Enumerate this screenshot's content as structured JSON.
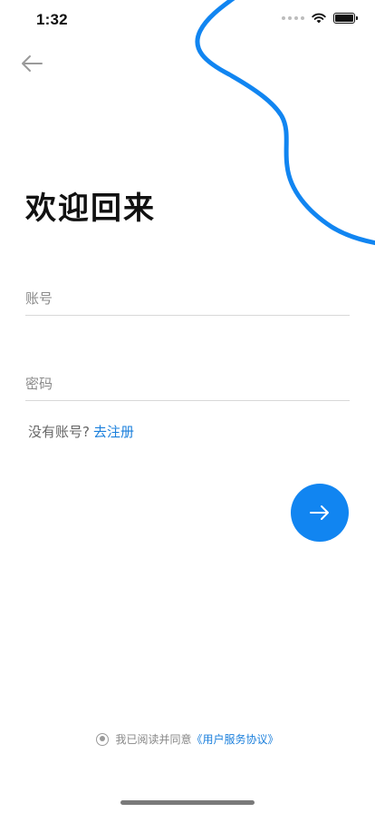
{
  "status_bar": {
    "time": "1:32"
  },
  "colors": {
    "accent": "#1185f1",
    "link": "#1a7fdc"
  },
  "header": {
    "back_icon": "arrow-left-icon"
  },
  "title": "欢迎回来",
  "form": {
    "account_placeholder": "账号",
    "account_value": "",
    "password_placeholder": "密码",
    "password_value": ""
  },
  "register": {
    "prompt": "没有账号?",
    "link_label": "去注册"
  },
  "submit": {
    "icon": "arrow-right-icon"
  },
  "agreement": {
    "text": "我已阅读并同意",
    "link_label": "《用户服务协议》"
  }
}
